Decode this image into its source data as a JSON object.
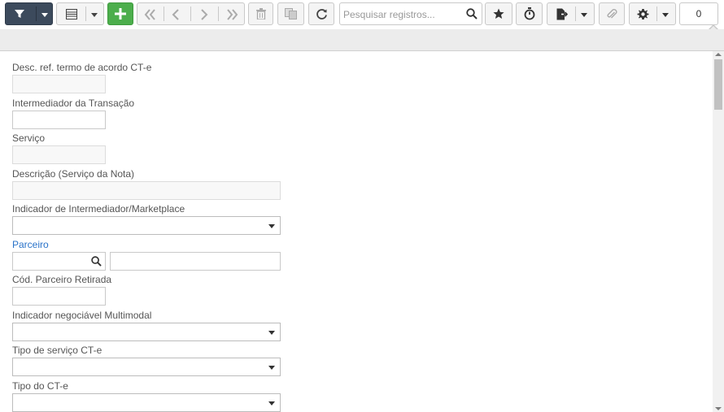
{
  "toolbar": {
    "filter_icon": "filter-icon",
    "grid_view_icon": "grid-view-icon",
    "add_icon": "plus-icon",
    "search_placeholder": "Pesquisar registros...",
    "record_counter": "0",
    "colors": {
      "dark_button": "#3c4a5c",
      "add_button": "#4cae4c",
      "link": "#2a73c9"
    }
  },
  "form": {
    "fields": [
      {
        "label": "Desc. ref. termo de acordo CT-e",
        "type": "readonly",
        "value": ""
      },
      {
        "label": "Intermediador da Transação",
        "type": "text",
        "value": ""
      },
      {
        "label": "Serviço",
        "type": "readonly",
        "value": ""
      },
      {
        "label": "Descrição (Serviço da Nota)",
        "type": "readonly",
        "value": ""
      },
      {
        "label": "Indicador de Intermediador/Marketplace",
        "type": "select",
        "value": ""
      },
      {
        "label": "Parceiro",
        "type": "lookup",
        "code_value": "",
        "name_value": ""
      },
      {
        "label": "Cód. Parceiro Retirada",
        "type": "text",
        "value": ""
      },
      {
        "label": "Indicador negociável Multimodal",
        "type": "select",
        "value": ""
      },
      {
        "label": "Tipo de serviço CT-e",
        "type": "select",
        "value": ""
      },
      {
        "label": "Tipo do CT-e",
        "type": "select",
        "value": ""
      }
    ]
  }
}
